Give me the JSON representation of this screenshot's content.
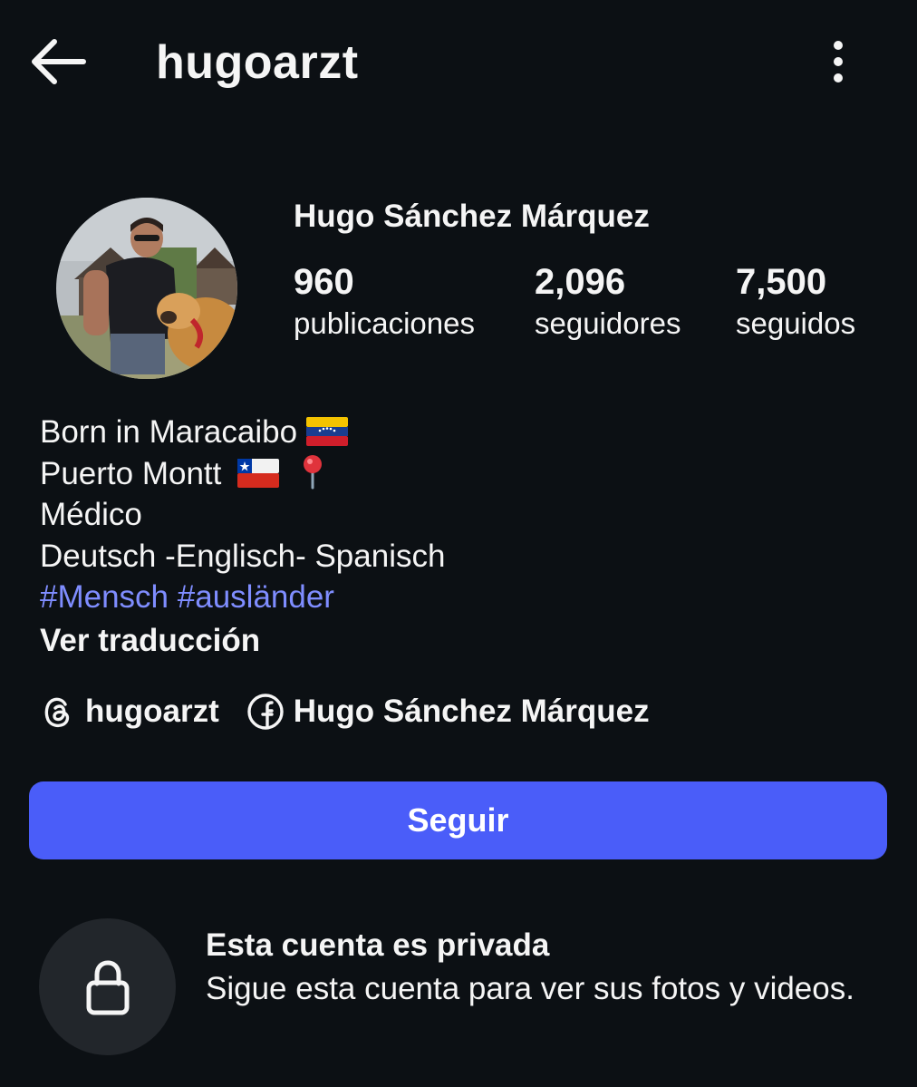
{
  "header": {
    "username": "hugoarzt",
    "back_icon": "arrow-left-icon",
    "more_icon": "more-vertical-icon"
  },
  "profile": {
    "display_name": "Hugo Sánchez Márquez",
    "avatar": "profile-photo-man-with-golden-retriever",
    "stats": [
      {
        "value": "960",
        "label": "publicaciones"
      },
      {
        "value": "2,096",
        "label": "seguidores"
      },
      {
        "value": "7,500",
        "label": "seguidos"
      }
    ]
  },
  "bio": {
    "line1": "Born in Maracaibo",
    "line1_flag": "venezuela-flag-icon",
    "line2": "Puerto Montt",
    "line2_flag": "chile-flag-icon",
    "line2_pin": "round-pushpin-icon",
    "line3": "Médico",
    "line4": "Deutsch -Englisch- Spanisch",
    "hashtags": [
      "#Mensch",
      "#ausländer"
    ],
    "translate_label": "Ver traducción"
  },
  "links": [
    {
      "icon": "threads-icon",
      "label": "hugoarzt"
    },
    {
      "icon": "facebook-icon",
      "label": "Hugo Sánchez Márquez"
    }
  ],
  "follow_button": {
    "label": "Seguir",
    "color": "#4a5df9"
  },
  "private_notice": {
    "icon": "lock-icon",
    "title": "Esta cuenta es privada",
    "description": "Sigue esta cuenta para ver sus fotos y videos."
  },
  "colors": {
    "background": "#0c1014",
    "text": "#f5f5f5",
    "hashtag": "#7f8dff",
    "lock_circle": "#22262b"
  }
}
